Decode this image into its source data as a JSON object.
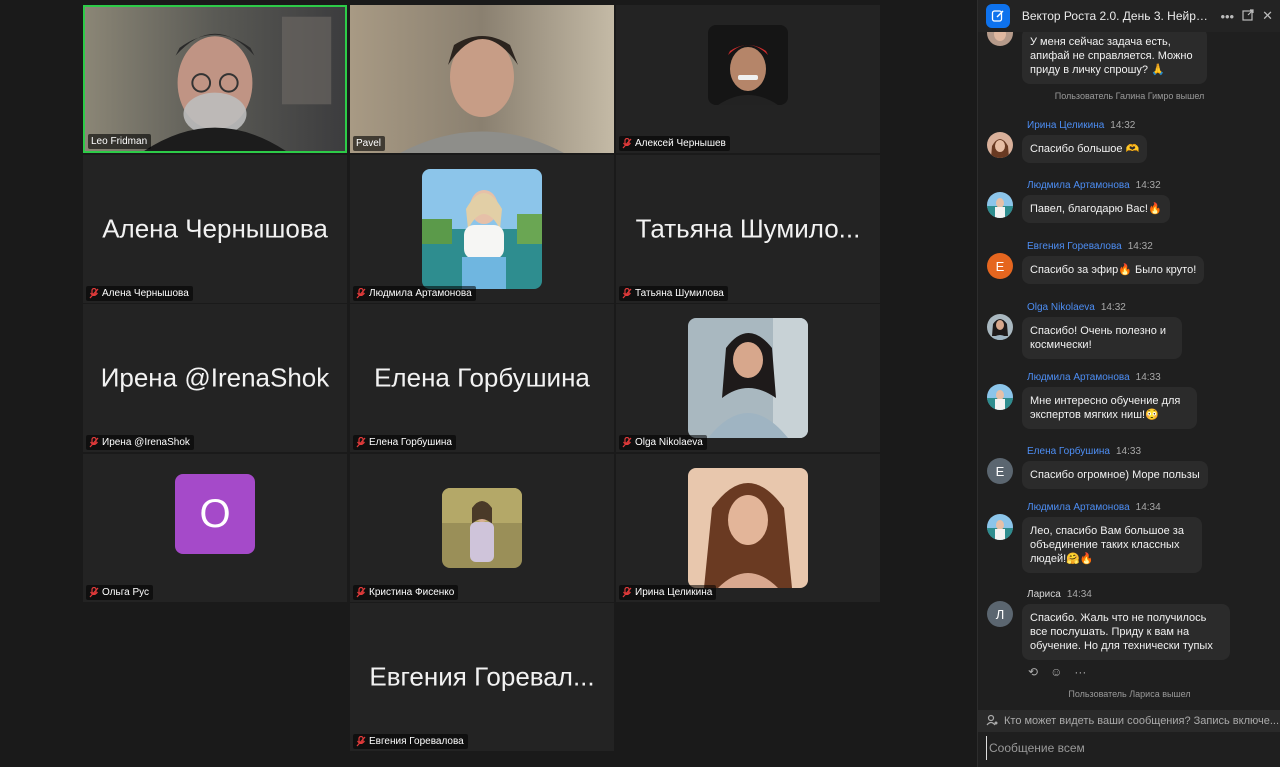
{
  "chat": {
    "title": "Вектор Роста 2.0. День 3. Нейрос...",
    "menu_icon": "more-icon",
    "popout_icon": "popout-icon",
    "close_icon": "close-icon",
    "messages_top": {
      "text": "У меня сейчас задача есть, апифай не справляется. Можно приду в личку спрошу? 🙏",
      "system": "Пользователь Галина Гимро вышел"
    },
    "messages": [
      {
        "name": "Ирина Целикина",
        "time": "14:32",
        "text": "Спасибо большое 🫶"
      },
      {
        "name": "Людмила Артамонова",
        "time": "14:32",
        "text": "Павел, благодарю Вас!🔥"
      },
      {
        "name": "Евгения Горевалова",
        "time": "14:32",
        "text": "Спасибо за эфир🔥 Было круто!",
        "letter": "Е"
      },
      {
        "name": "Olga Nikolaeva",
        "time": "14:32",
        "text": "Спасибо! Очень полезно и космически!"
      },
      {
        "name": "Людмила Артамонова",
        "time": "14:33",
        "text": "Мне интересно обучение для экспертов мягких ниш!😳"
      },
      {
        "name": "Елена Горбушина",
        "time": "14:33",
        "text": "Спасибо огромное) Море пользы",
        "letter": "Е"
      },
      {
        "name": "Людмила Артамонова",
        "time": "14:34",
        "text": "Лео, спасибо Вам большое за объединение таких классных людей!🤗🔥"
      },
      {
        "name": "Лариса",
        "time": "14:34",
        "text": "Спасибо. Жаль что не получилось все послушать. Приду к вам на обучение. Но для технически тупых",
        "letter": "Л"
      }
    ],
    "system_bottom": "Пользователь Лариса вышел",
    "notice": "Кто может видеть ваши сообщения? Запись включе...",
    "composer_placeholder": "Сообщение всем"
  },
  "participants": [
    {
      "name": "Leo Fridman"
    },
    {
      "name": "Pavel"
    },
    {
      "name": "Алексей Чернышев"
    },
    {
      "name": "Алена Чернышова"
    },
    {
      "name": "Людмила Артамонова"
    },
    {
      "name": "Татьяна Шумилова",
      "display": "Татьяна Шумило..."
    },
    {
      "name": "Ирена @IrenaShok"
    },
    {
      "name": "Елена Горбушина"
    },
    {
      "name": "Olga Nikolaeva"
    },
    {
      "name": "Ольга Рус",
      "letter": "О"
    },
    {
      "name": "Кристина Фисенко"
    },
    {
      "name": "Ирина Целикина"
    },
    {
      "name": "Евгения Горевалова",
      "display": "Евгения Горевал..."
    }
  ],
  "colors": {
    "active_speaker": "#2dcb48",
    "sender_name": "#4d8ef4",
    "avatar_purple": "#a54ac9",
    "avatar_orange": "#e5661f",
    "avatar_gray": "#5b6670"
  }
}
